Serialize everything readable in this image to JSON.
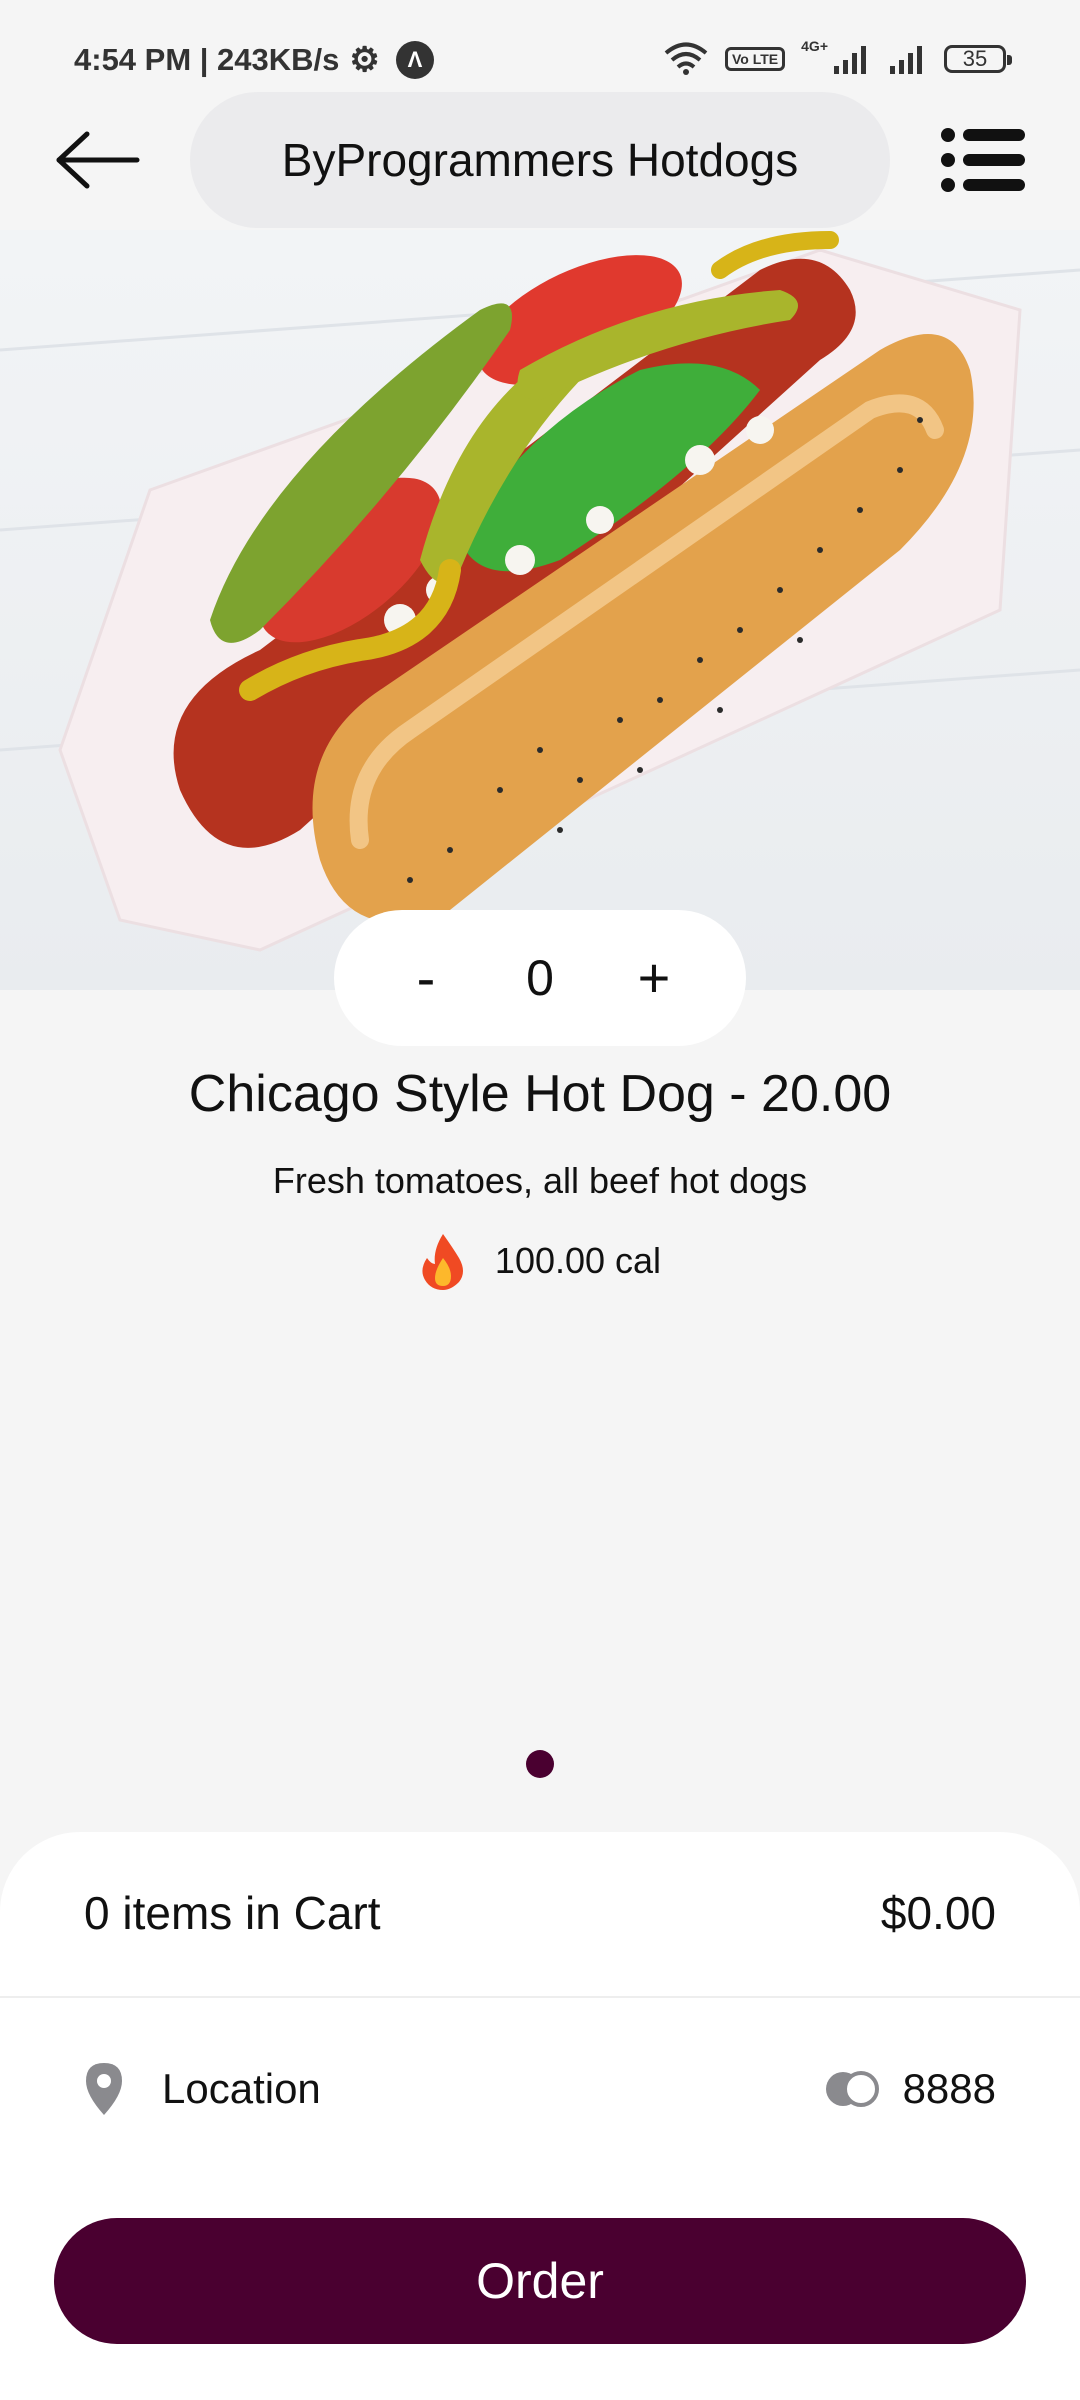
{
  "status_bar": {
    "time_speed": "4:54 PM | 243KB/s",
    "network_label": "4G+",
    "volte_label": "Vo LTE",
    "battery": "35"
  },
  "header": {
    "title": "ByProgrammers Hotdogs",
    "back_icon": "arrow-left-icon",
    "menu_icon": "list-icon"
  },
  "product": {
    "image_alt": "hot-dog-photo",
    "quantity": "0",
    "decrement_label": "-",
    "increment_label": "+",
    "title": "Chicago Style Hot Dog - 20.00",
    "description": "Fresh tomatoes, all beef hot dogs",
    "calories": "100.00 cal",
    "calorie_icon": "fire-icon"
  },
  "pagination": {
    "pages": 1,
    "active": 0
  },
  "cart": {
    "items_label": "0 items in Cart",
    "total": "$0.00",
    "location_label": "Location",
    "points": "8888",
    "order_label": "Order"
  },
  "colors": {
    "accent": "#4a0030",
    "background": "#f5f5f5",
    "pill": "#ebebed"
  }
}
